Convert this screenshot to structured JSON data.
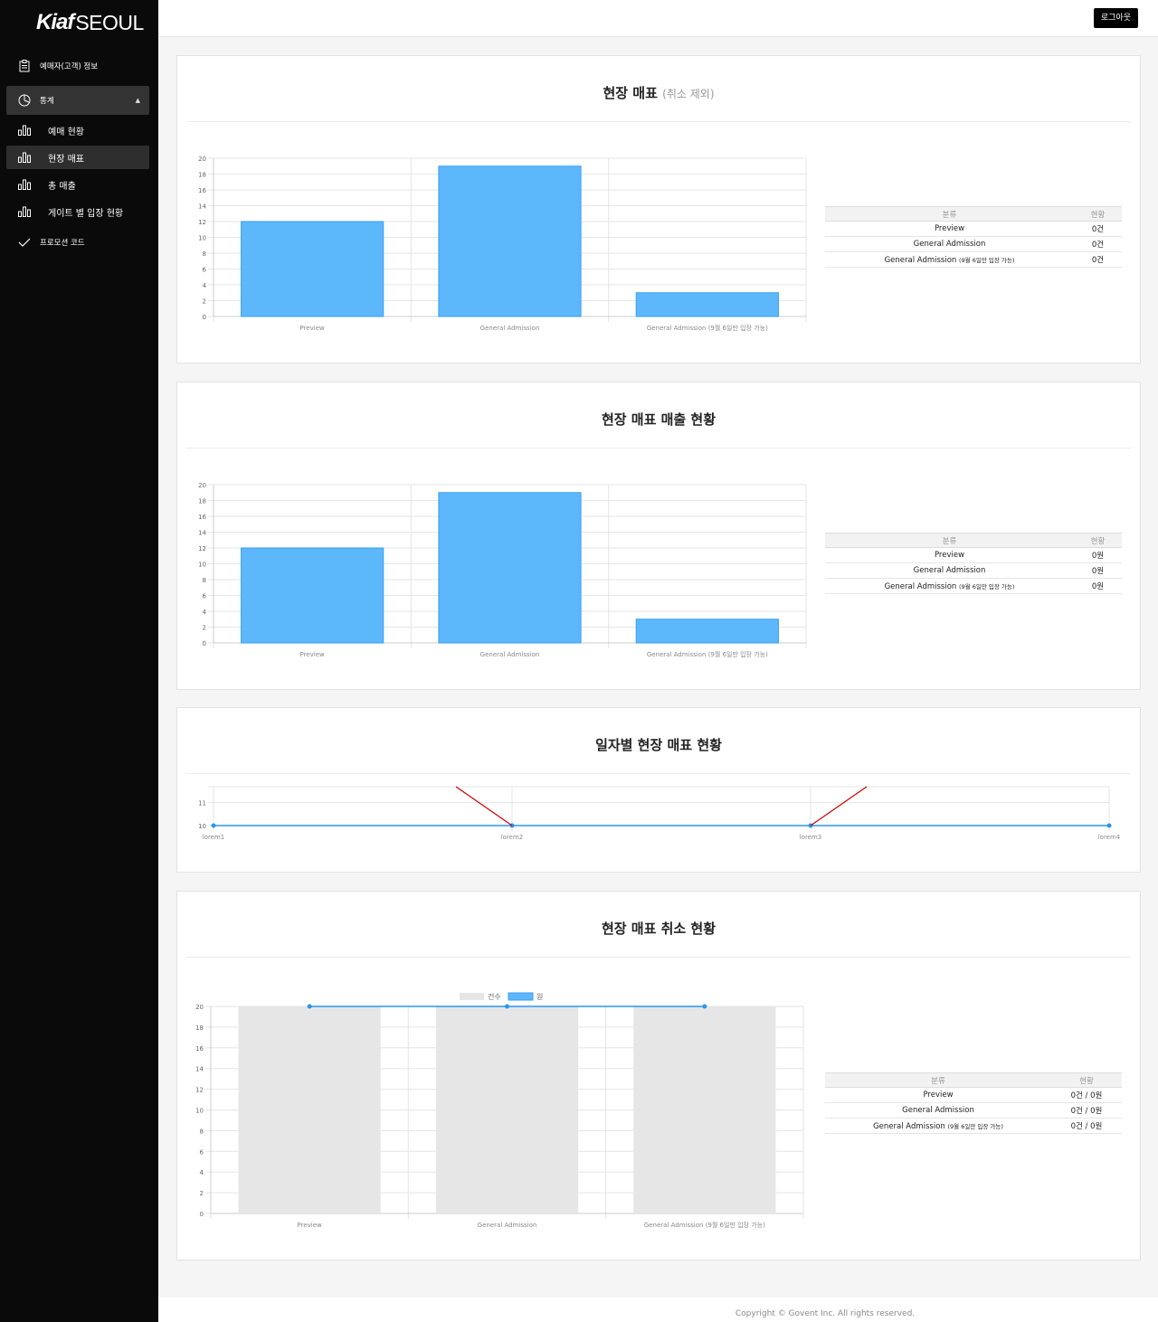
{
  "logo": {
    "kiaf": "Kiaf",
    "seoul": "SEOUL"
  },
  "sidebar": {
    "customer_info": "예매자(고객) 정보",
    "stats": "통계",
    "sub_items": [
      "예매 현황",
      "현장 매표",
      "총 매출",
      "게이트 별 입장 현황"
    ],
    "promo": "프로모션 코드"
  },
  "header": {
    "logout": "로그아웃"
  },
  "cards": {
    "onsite": {
      "title": "현장 매표",
      "subtitle": "(취소 제외)"
    },
    "sales": {
      "title": "현장 매표 매출 현황"
    },
    "daily": {
      "title": "일자별 현장 매표 현황"
    },
    "cancel": {
      "title": "현장 매표 취소 현황"
    }
  },
  "tables": {
    "header": {
      "category": "분류",
      "status": "현황"
    },
    "ga_prefix": "General Admission",
    "ga_suffix": "(9월 6일만 입장 가능)",
    "onsite_rows": [
      {
        "category": "Preview",
        "status": "0건"
      },
      {
        "category": "General Admission",
        "status": "0건"
      },
      {
        "status": "0건"
      }
    ],
    "sales_rows": [
      {
        "category": "Preview",
        "status": "0원"
      },
      {
        "category": "General Admission",
        "status": "0원"
      },
      {
        "status": "0원"
      }
    ],
    "cancel_rows": [
      {
        "category": "Preview",
        "status": "0건 / 0원"
      },
      {
        "category": "General Admission",
        "status": "0건 / 0원"
      },
      {
        "status": "0건 / 0원"
      }
    ]
  },
  "footer": {
    "copyright": "Copyright © Govent Inc. All rights reserved."
  },
  "colors": {
    "bar_blue": "#5cb8fb",
    "bar_border": "#3a9ef0",
    "bar_gray": "#e6e6e6",
    "line_blue": "#2a96f0",
    "annotation_red": "#cc0000"
  },
  "chart_data": [
    {
      "type": "bar",
      "categories": [
        "Preview",
        "General Admission",
        "General Admission (9월 6일만 입장 가능)"
      ],
      "values": [
        12,
        19,
        3
      ],
      "ylim": [
        0,
        20
      ],
      "yticks": [
        0,
        2,
        4,
        6,
        8,
        10,
        12,
        14,
        16,
        18,
        20
      ]
    },
    {
      "type": "bar",
      "categories": [
        "Preview",
        "General Admission",
        "General Admission (9월 6일만 입장 가능)"
      ],
      "values": [
        12,
        19,
        3
      ],
      "ylim": [
        0,
        20
      ],
      "yticks": [
        0,
        2,
        4,
        6,
        8,
        10,
        12,
        14,
        16,
        18,
        20
      ]
    },
    {
      "type": "line",
      "x": [
        "lorem1",
        "lorem2",
        "lorem3",
        "lorem4"
      ],
      "values": [
        10,
        10,
        10,
        10
      ],
      "ylim": [
        10,
        11.5
      ],
      "yticks": [
        10,
        11
      ]
    },
    {
      "type": "bar",
      "categories": [
        "Preview",
        "General Admission",
        "General Admission (9월 6일만 입장 가능)"
      ],
      "series": [
        {
          "name": "건수",
          "type": "bar",
          "values": [
            20,
            20,
            20
          ]
        },
        {
          "name": "원",
          "type": "line",
          "values": [
            20,
            20,
            20
          ]
        }
      ],
      "ylim": [
        0,
        20
      ],
      "yticks": [
        0,
        2,
        4,
        6,
        8,
        10,
        12,
        14,
        16,
        18,
        20
      ],
      "legend": "top"
    }
  ]
}
